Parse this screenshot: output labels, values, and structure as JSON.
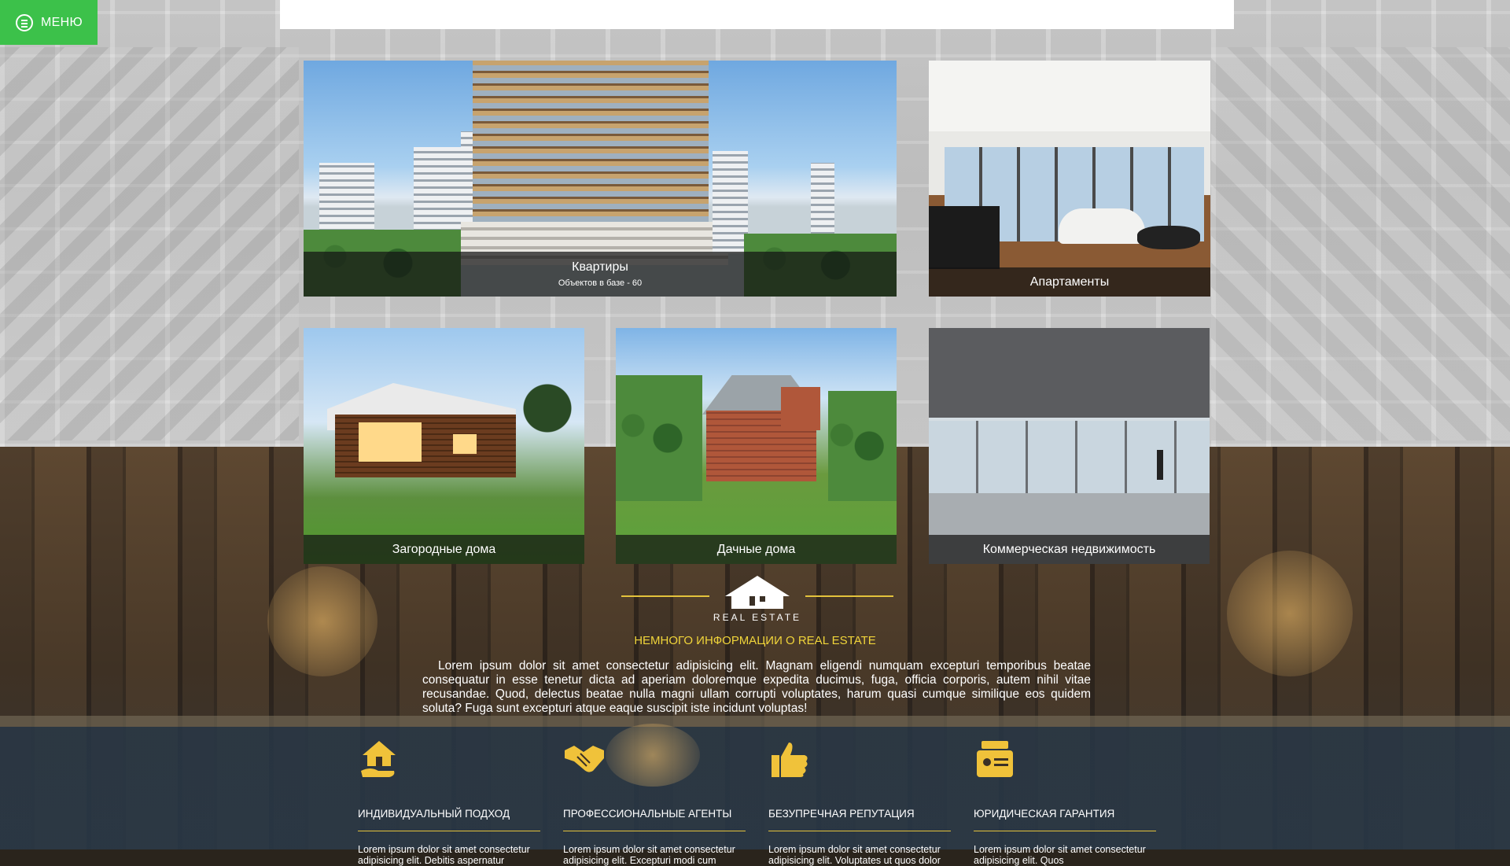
{
  "menu": {
    "label": "МЕНЮ"
  },
  "tiles": [
    {
      "title": "Квартиры",
      "subtitle": "Объектов в базе - 60"
    },
    {
      "title": "Апартаменты"
    },
    {
      "title": "Загородные дома"
    },
    {
      "title": "Дачные дома"
    },
    {
      "title": "Коммерческая недвижимость"
    }
  ],
  "logo": {
    "text": "REAL ESTATE"
  },
  "info": {
    "title": "НЕМНОГО ИНФОРМАЦИИ О REAL ESTATE",
    "text": "Lorem ipsum dolor sit amet consectetur adipisicing elit. Magnam eligendi numquam excepturi temporibus beatae consequatur in esse tenetur dicta ad aperiam doloremque expedita ducimus, fuga, officia corporis, autem nihil vitae recusandae. Quod, delectus beatae nulla magni ullam corrupti voluptates, harum quasi cumque similique eos quidem soluta? Fuga sunt excepturi atque eaque suscipit iste incidunt voluptas!"
  },
  "features": [
    {
      "icon": "house-hand-icon",
      "title": "ИНДИВИДУАЛЬНЫЙ ПОДХОД",
      "text": "Lorem ipsum dolor sit amet consectetur adipisicing elit. Debitis aspernatur"
    },
    {
      "icon": "handshake-icon",
      "title": "ПРОФЕССИОНАЛЬНЫЕ АГЕНТЫ",
      "text": "Lorem ipsum dolor sit amet consectetur adipisicing elit. Excepturi modi cum"
    },
    {
      "icon": "thumbs-up-icon",
      "title": "БЕЗУПРЕЧНАЯ РЕПУТАЦИЯ",
      "text": "Lorem ipsum dolor sit amet consectetur adipisicing elit. Voluptates ut quos dolor"
    },
    {
      "icon": "document-icon",
      "title": "ЮРИДИЧЕСКАЯ ГАРАНТИЯ",
      "text": "Lorem ipsum dolor sit amet consectetur adipisicing elit. Quos"
    }
  ],
  "colors": {
    "accent_green": "#3cc14a",
    "accent_gold": "#e3c23c",
    "title_yellow": "#f0d43a"
  }
}
